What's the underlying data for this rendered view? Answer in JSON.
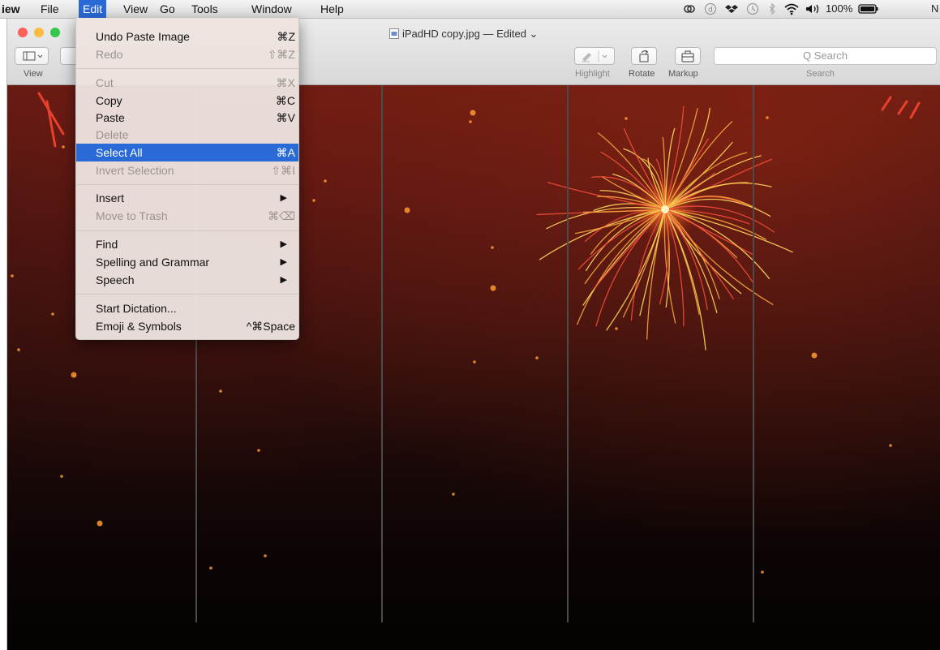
{
  "menubar": {
    "items": [
      "iew",
      "File",
      "Edit",
      "View",
      "Go",
      "Tools",
      "Window",
      "Help"
    ],
    "battery": "100%",
    "trailing": "N"
  },
  "window": {
    "title": "iPadHD copy.jpg — Edited ⌄",
    "toolbar": {
      "view_label": "View",
      "highlight_label": "Highlight",
      "rotate_label": "Rotate",
      "markup_label": "Markup",
      "search_placeholder": "Q Search",
      "search_label": "Search"
    }
  },
  "edit_menu": {
    "items": [
      {
        "label": "Undo Paste Image",
        "shortcut": "⌘Z",
        "enabled": true
      },
      {
        "label": "Redo",
        "shortcut": "⇧⌘Z",
        "enabled": false
      },
      {
        "label": "Cut",
        "shortcut": "⌘X",
        "enabled": false
      },
      {
        "label": "Copy",
        "shortcut": "⌘C",
        "enabled": true
      },
      {
        "label": "Paste",
        "shortcut": "⌘V",
        "enabled": true
      },
      {
        "label": "Delete",
        "shortcut": "",
        "enabled": false
      },
      {
        "label": "Select All",
        "shortcut": "⌘A",
        "enabled": true,
        "selected": true
      },
      {
        "label": "Invert Selection",
        "shortcut": "⇧⌘I",
        "enabled": false
      },
      {
        "label": "Insert",
        "shortcut": "▶",
        "enabled": true
      },
      {
        "label": "Move to Trash",
        "shortcut": "⌘⌫",
        "enabled": false
      },
      {
        "label": "Find",
        "shortcut": "▶",
        "enabled": true
      },
      {
        "label": "Spelling and Grammar",
        "shortcut": "▶",
        "enabled": true
      },
      {
        "label": "Speech",
        "shortcut": "▶",
        "enabled": true
      },
      {
        "label": "Start Dictation...",
        "shortcut": "",
        "enabled": true
      },
      {
        "label": "Emoji & Symbols",
        "shortcut": "^⌘Space",
        "enabled": true
      }
    ]
  },
  "colors": {
    "menu_highlight": "#2a6ad6",
    "traffic_close": "#fc605b",
    "traffic_min": "#fdbc40",
    "traffic_max": "#34c84a"
  }
}
